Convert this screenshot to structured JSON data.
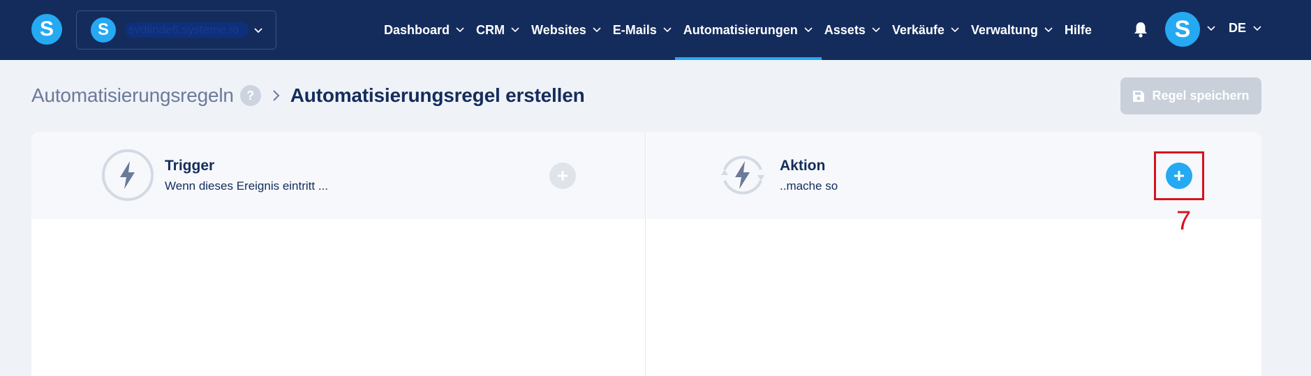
{
  "app": {
    "logo_letter": "S",
    "accent_color": "#25a9f2",
    "nav_bg": "#142c5c"
  },
  "workspace": {
    "avatar_letter": "S",
    "name": "svdlinde6.systeme.io"
  },
  "nav": {
    "items": [
      {
        "label": "Dashboard",
        "dropdown": true
      },
      {
        "label": "CRM",
        "dropdown": true
      },
      {
        "label": "Websites",
        "dropdown": true
      },
      {
        "label": "E-Mails",
        "dropdown": true
      },
      {
        "label": "Automatisierungen",
        "dropdown": true,
        "active": true
      },
      {
        "label": "Assets",
        "dropdown": true
      },
      {
        "label": "Verkäufe",
        "dropdown": true
      },
      {
        "label": "Verwaltung",
        "dropdown": true
      },
      {
        "label": "Hilfe",
        "dropdown": false
      }
    ],
    "user_avatar_letter": "S",
    "language": "DE"
  },
  "header": {
    "breadcrumb_parent": "Automatisierungsregeln",
    "help_badge": "?",
    "breadcrumb_current": "Automatisierungsregel erstellen",
    "save_label": "Regel speichern"
  },
  "trigger": {
    "title": "Trigger",
    "subtitle": "Wenn dieses Ereignis eintritt ..."
  },
  "action": {
    "title": "Aktion",
    "subtitle": "..mache so"
  },
  "annotation": {
    "marker": "7"
  }
}
